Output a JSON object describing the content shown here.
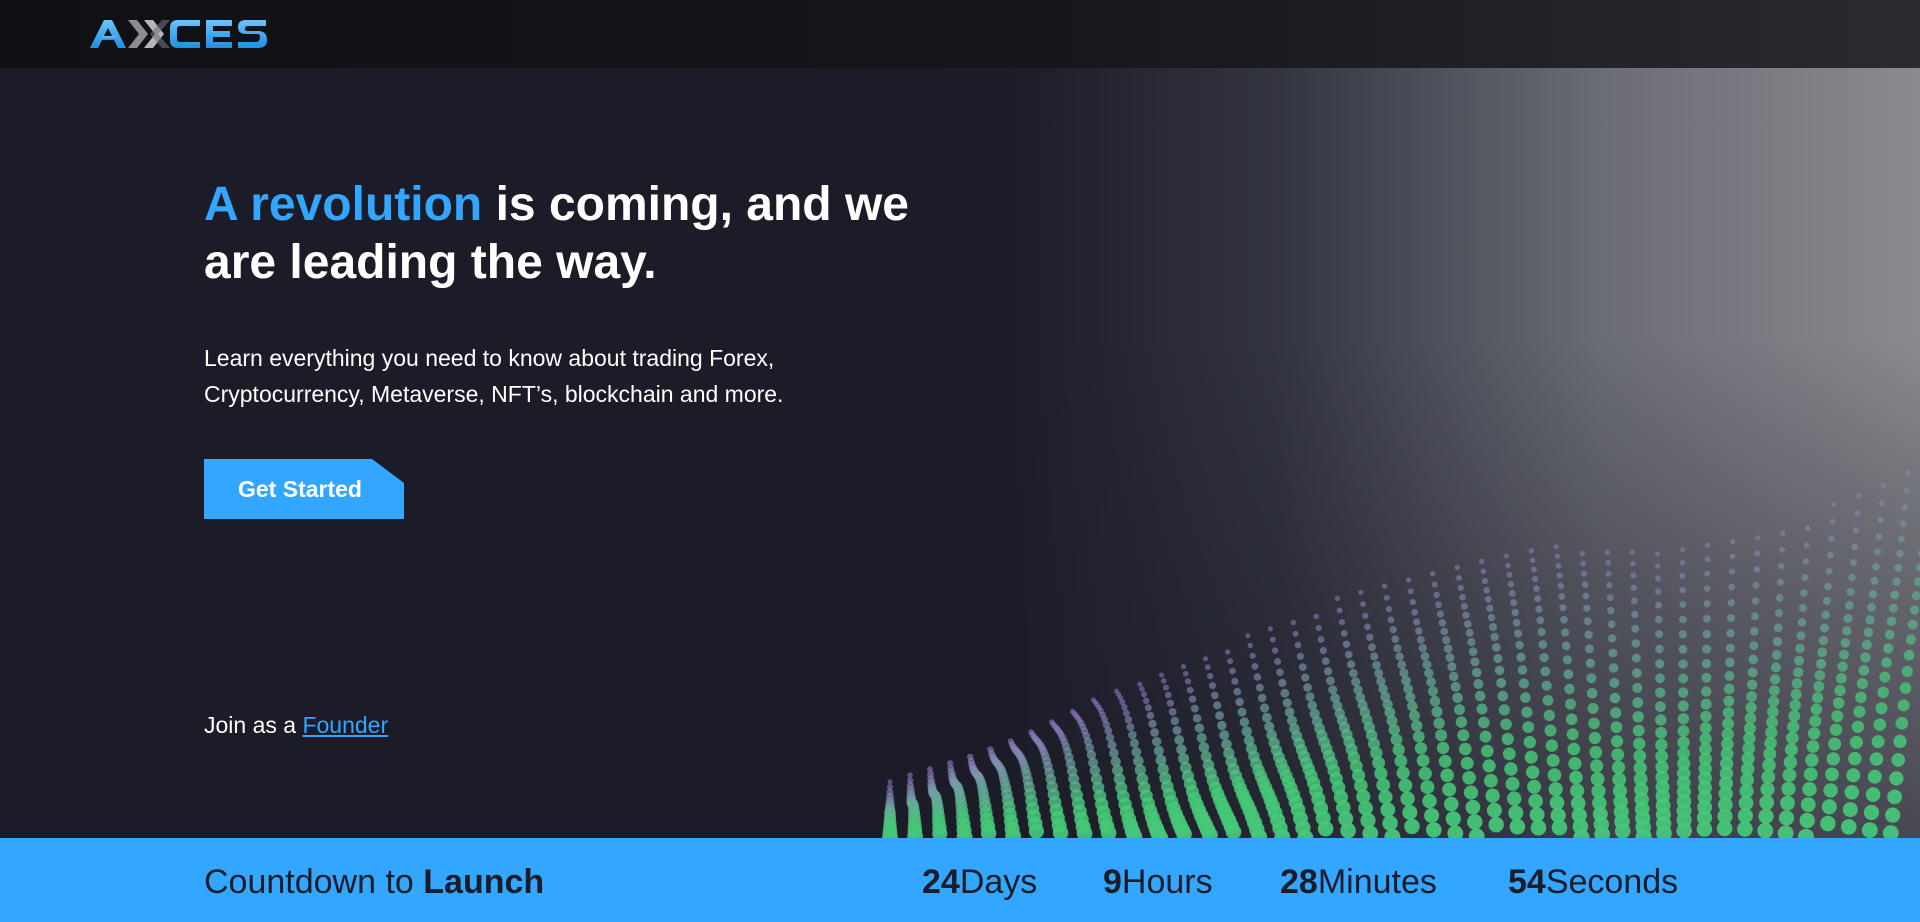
{
  "brand": {
    "logo_text": "AXXCES"
  },
  "hero": {
    "headline_accent": "A revolution",
    "headline_rest_line1": " is coming, and we",
    "headline_line2": "are leading the way.",
    "subtext_line1": "Learn everything you need to know about trading Forex,",
    "subtext_line2": "Cryptocurrency, Metaverse, NFT’s, blockchain and more.",
    "cta_label": "Get Started",
    "join_prefix": "Join as a ",
    "join_link": "Founder"
  },
  "countdown": {
    "label_prefix": "Countdown to ",
    "label_bold": "Launch",
    "units": [
      {
        "value": "24",
        "label": "Days"
      },
      {
        "value": "9",
        "label": "Hours"
      },
      {
        "value": "28",
        "label": "Minutes"
      },
      {
        "value": "54",
        "label": "Seconds"
      }
    ]
  },
  "colors": {
    "accent": "#33a6ff",
    "background": "#1b1c28",
    "header": "#0f1014"
  }
}
